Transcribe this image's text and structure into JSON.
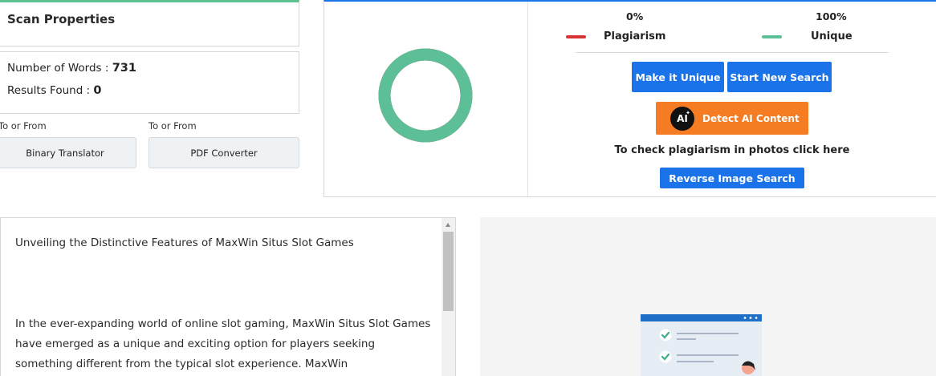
{
  "scan": {
    "title": "Scan Properties",
    "words_label": "Number of Words : ",
    "words_value": "731",
    "results_label": "Results Found : ",
    "results_value": "0"
  },
  "tools": [
    {
      "label": "To or From",
      "button": "Binary Translator"
    },
    {
      "label": "To or From",
      "button": "PDF Converter"
    }
  ],
  "result": {
    "plagiarism_pct": "0%",
    "unique_pct": "100%",
    "plagiarism_label": "Plagiarism",
    "unique_label": "Unique",
    "plagiarism_color": "#d93434",
    "unique_color": "#5cbf97",
    "unique_fraction": 1.0
  },
  "actions": {
    "make_unique": "Make it Unique",
    "start_new": "Start New Search",
    "ai_badge": "AI",
    "detect_ai": "Detect AI Content",
    "photo_text": "To check plagiarism in photos click here",
    "reverse_image": "Reverse Image Search"
  },
  "editor": {
    "heading": "Unveiling the Distinctive Features of MaxWin Situs Slot Games",
    "paragraph": "In the ever-expanding world of online slot gaming, MaxWin Situs Slot Games have emerged as a unique and exciting option for players seeking something different from the typical slot experience. MaxWin"
  },
  "icons": {
    "scroll_up": "scroll-up-arrow-icon",
    "illustration": "document-checklist-illustration"
  }
}
